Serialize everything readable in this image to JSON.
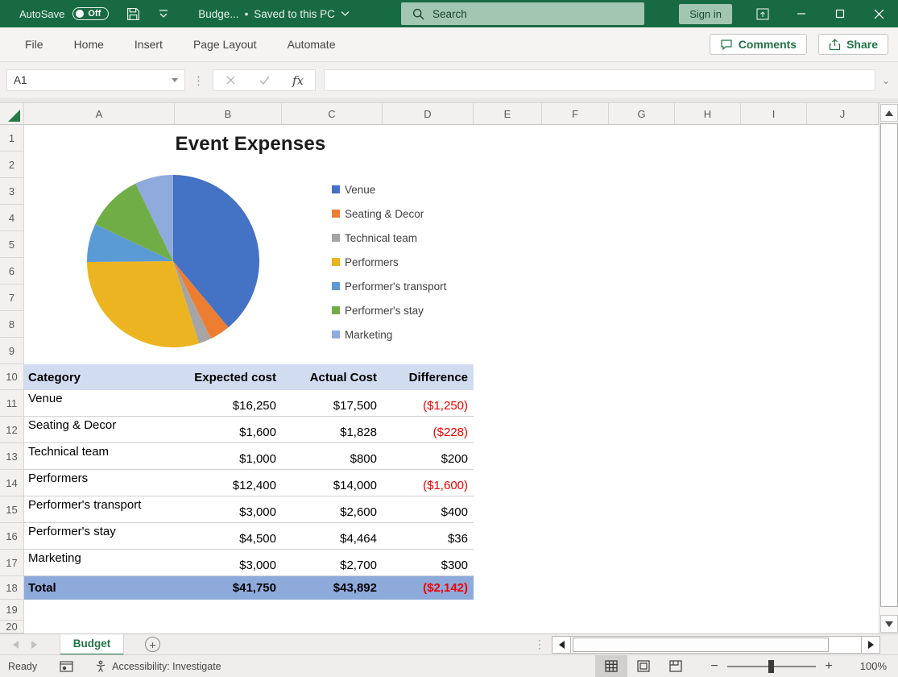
{
  "colors": {
    "titlebar_green": "#186A42",
    "accent_green": "#217346",
    "search_pill_green": "#A3C6B2",
    "negative_red": "#F00000",
    "table_header_fill": "#D2DCF1",
    "table_total_fill": "#8EAADB"
  },
  "titlebar": {
    "autosave_label": "AutoSave",
    "autosave_state": "Off",
    "doc_title": "Budge...",
    "separator": "•",
    "doc_status": "Saved to this PC",
    "search_placeholder": "Search",
    "sign_in_label": "Sign in"
  },
  "ribbon": {
    "tabs": [
      "File",
      "Home",
      "Insert",
      "Page Layout",
      "Automate"
    ],
    "comments_label": "Comments",
    "share_label": "Share"
  },
  "formula_bar": {
    "name_box_value": "A1",
    "fx_label": "fx",
    "formula_value": ""
  },
  "grid": {
    "column_headers": [
      "A",
      "B",
      "C",
      "D",
      "E",
      "F",
      "G",
      "H",
      "I",
      "J"
    ],
    "row_headers": [
      "1",
      "2",
      "3",
      "4",
      "5",
      "6",
      "7",
      "8",
      "9",
      "10",
      "11",
      "12",
      "13",
      "14",
      "15",
      "16",
      "17",
      "18",
      "19",
      "20"
    ]
  },
  "chart_data": {
    "type": "pie",
    "title": "Event Expenses",
    "categories": [
      "Venue",
      "Seating & Decor",
      "Technical team",
      "Performers",
      "Performer's transport",
      "Performer's stay",
      "Marketing"
    ],
    "values": [
      16250,
      1600,
      1000,
      12400,
      3000,
      4500,
      3000
    ],
    "colors": [
      "#4472C4",
      "#ED7D31",
      "#A5A5A5",
      "#EDB421",
      "#5B9BD5",
      "#70AD47",
      "#8FAADC"
    ],
    "legend_position": "right",
    "start_angle_deg": 0,
    "direction": "clockwise"
  },
  "table": {
    "headers": [
      "Category",
      "Expected cost",
      "Actual Cost",
      "Difference"
    ],
    "rows": [
      [
        "Venue",
        "$16,250",
        "$17,500",
        "($1,250)"
      ],
      [
        "Seating & Decor",
        "$1,600",
        "$1,828",
        "($228)"
      ],
      [
        "Technical team",
        "$1,000",
        "$800",
        "$200"
      ],
      [
        "Performers",
        "$12,400",
        "$14,000",
        "($1,600)"
      ],
      [
        "Performer's transport",
        "$3,000",
        "$2,600",
        "$400"
      ],
      [
        "Performer's stay",
        "$4,500",
        "$4,464",
        "$36"
      ],
      [
        "Marketing",
        "$3,000",
        "$2,700",
        "$300"
      ]
    ],
    "total_row": [
      "Total",
      "$41,750",
      "$43,892",
      "($2,142)"
    ]
  },
  "sheet_tabs": {
    "active_tab": "Budget",
    "add_sheet_glyph": "+"
  },
  "status_bar": {
    "ready_label": "Ready",
    "accessibility_label": "Accessibility: Investigate",
    "zoom_level": "100%"
  }
}
